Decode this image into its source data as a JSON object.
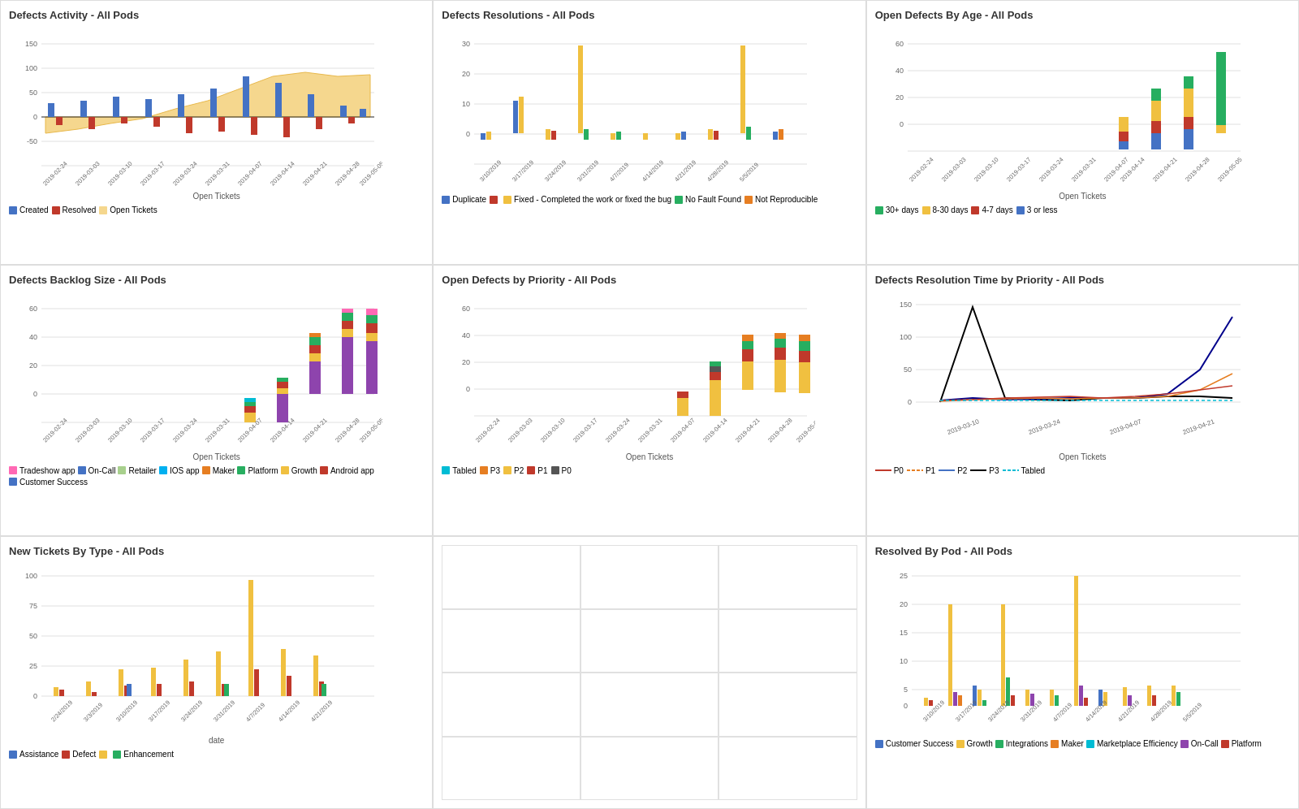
{
  "panels": [
    {
      "id": "defects-activity",
      "title": "Defects Activity - All Pods",
      "xLabel": "Open Tickets",
      "legend": [
        {
          "label": "Created",
          "color": "#4472c4"
        },
        {
          "label": "Resolved",
          "color": "#c0392b"
        },
        {
          "label": "Open Tickets",
          "color": "#f5d78e"
        }
      ]
    },
    {
      "id": "defects-resolutions",
      "title": "Defects Resolutions - All Pods",
      "xLabel": "",
      "legend": [
        {
          "label": "Duplicate",
          "color": "#4472c4"
        },
        {
          "label": "",
          "color": "#c0392b"
        },
        {
          "label": "Fixed - Completed the work or fixed the bug",
          "color": "#f0c040"
        },
        {
          "label": "No Fault Found",
          "color": "#27ae60"
        },
        {
          "label": "Not Reproducible",
          "color": "#e67e22"
        }
      ]
    },
    {
      "id": "open-defects-age",
      "title": "Open Defects By Age - All Pods",
      "xLabel": "Open Tickets",
      "legend": [
        {
          "label": "30+ days",
          "color": "#27ae60"
        },
        {
          "label": "8-30 days",
          "color": "#f0c040"
        },
        {
          "label": "4-7 days",
          "color": "#c0392b"
        },
        {
          "label": "3 or less",
          "color": "#4472c4"
        }
      ]
    },
    {
      "id": "defects-backlog",
      "title": "Defects Backlog Size - All Pods",
      "xLabel": "Open Tickets",
      "legend": [
        {
          "label": "Tradeshow app",
          "color": "#ff69b4"
        },
        {
          "label": "On-Call",
          "color": "#4472c4"
        },
        {
          "label": "Retailer",
          "color": "#a8d08d"
        },
        {
          "label": "IOS app",
          "color": "#00b0f0"
        },
        {
          "label": "Maker",
          "color": "#e67e22"
        },
        {
          "label": "Platform",
          "color": "#27ae60"
        },
        {
          "label": "Growth",
          "color": "#f0c040"
        },
        {
          "label": "Android app",
          "color": "#c0392b"
        },
        {
          "label": "Customer Success",
          "color": "#4472c4"
        }
      ]
    },
    {
      "id": "open-defects-priority",
      "title": "Open Defects by Priority - All Pods",
      "xLabel": "Open Tickets",
      "legend": [
        {
          "label": "Tabled",
          "color": "#00bcd4"
        },
        {
          "label": "P3",
          "color": "#e67e22"
        },
        {
          "label": "P2",
          "color": "#f0c040"
        },
        {
          "label": "P1",
          "color": "#c0392b"
        },
        {
          "label": "P0",
          "color": "#555"
        }
      ]
    },
    {
      "id": "defects-resolution-time",
      "title": "Defects Resolution Time by Priority - All Pods",
      "xLabel": "Open Tickets",
      "legend": [
        {
          "label": "P0",
          "color": "#c0392b",
          "dash": false
        },
        {
          "label": "P1",
          "color": "#e67e22",
          "dash": false
        },
        {
          "label": "P2",
          "color": "#4472c4",
          "dash": false
        },
        {
          "label": "P3",
          "color": "#000",
          "dash": false
        },
        {
          "label": "Tabled",
          "color": "#00bcd4",
          "dash": true
        }
      ]
    },
    {
      "id": "new-tickets-type",
      "title": "New Tickets By Type - All Pods",
      "xLabel": "date",
      "legend": [
        {
          "label": "Assistance",
          "color": "#4472c4"
        },
        {
          "label": "Defect",
          "color": "#c0392b"
        },
        {
          "label": "Enhancement",
          "color": "#27ae60"
        }
      ]
    },
    {
      "id": "empty-middle",
      "title": "",
      "empty": true
    },
    {
      "id": "resolved-by-pod",
      "title": "Resolved By Pod - All Pods",
      "xLabel": "",
      "legend": [
        {
          "label": "Customer Success",
          "color": "#4472c4"
        },
        {
          "label": "Growth",
          "color": "#f0c040"
        },
        {
          "label": "Integrations",
          "color": "#27ae60"
        },
        {
          "label": "Maker",
          "color": "#e67e22"
        },
        {
          "label": "Marketplace Efficiency",
          "color": "#00bcd4"
        },
        {
          "label": "On-Call",
          "color": "#8e44ad"
        },
        {
          "label": "Platform",
          "color": "#c0392b"
        }
      ]
    }
  ]
}
